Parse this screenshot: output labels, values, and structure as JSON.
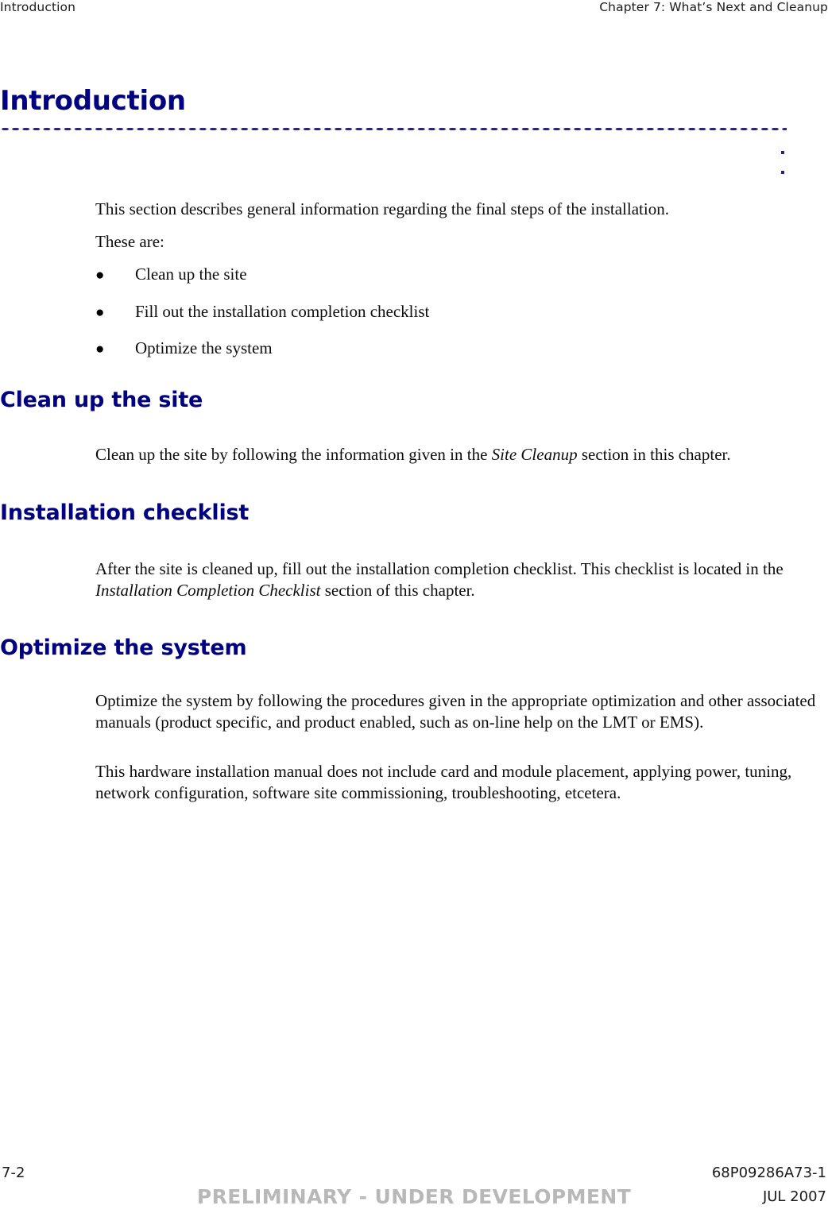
{
  "header": {
    "left": "Introduction",
    "right": "Chapter 7: What’s Next and Cleanup"
  },
  "title": {
    "text": "Introduction"
  },
  "intro": {
    "paragraph_1": "This section describes general information regarding the final steps of the installation.",
    "paragraph_2": "These are:",
    "bullet_glyph": "●",
    "bullets": [
      {
        "label": "Clean up the site"
      },
      {
        "label": "Fill out the installation completion checklist"
      },
      {
        "label": "Optimize the system"
      }
    ]
  },
  "sections": [
    {
      "heading": "Clean up the site",
      "paragraph_pre": "Clean up the site by following the information given in the ",
      "paragraph_italic": "Site Cleanup",
      "paragraph_post": " section in this chapter."
    },
    {
      "heading": "Installation checklist",
      "paragraph_pre": "After the site is cleaned up, fill out the installation completion checklist. This checklist is located in the ",
      "paragraph_italic": "Installation Completion Checklist",
      "paragraph_post": " section of this chapter."
    },
    {
      "heading": "Optimize the system",
      "paragraph_1": "Optimize the system by following the procedures given in the appropriate optimization and other associated manuals (product specific, and product enabled, such as on-line help on the LMT or EMS).",
      "paragraph_2": "This hardware installation manual does not include card and module placement, applying power, tuning, network configuration, software site commissioning, troubleshooting, etcetera."
    }
  ],
  "footer": {
    "page_number": "7-2",
    "document_id": "68P09286A73-1",
    "watermark": "PRELIMINARY - UNDER DEVELOPMENT",
    "date": "JUL 2007"
  },
  "colors": {
    "heading": "#000080",
    "dot_rule": "#23238c",
    "body_text": "#0d0d0d",
    "watermark": "#b8b8b8"
  }
}
